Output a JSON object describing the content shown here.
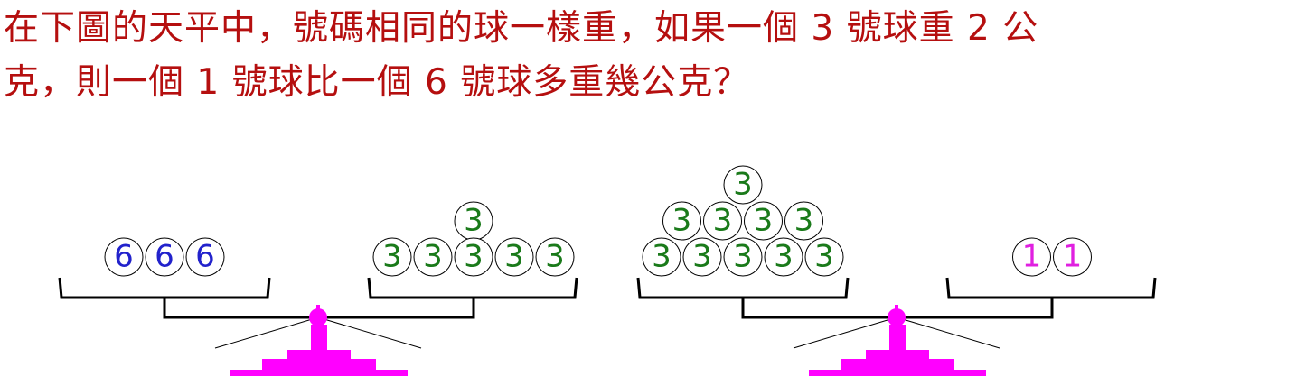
{
  "question": {
    "line1": "在下圖的天平中，號碼相同的球一樣重，如果一個 3 號球重 2 公",
    "line2": "克，則一個 1 號球比一個 6 號球多重幾公克？"
  },
  "colors": {
    "question_text": "#b50f0f",
    "scale_body": "#ff00ff",
    "ball_6": "#2222cc",
    "ball_3": "#1a7a1a",
    "ball_1": "#e020e0",
    "pan_outline": "#000000"
  },
  "scales": [
    {
      "left_pan": {
        "rows": [
          [
            "6",
            "6",
            "6"
          ]
        ]
      },
      "right_pan": {
        "rows": [
          [
            "3"
          ],
          [
            "3",
            "3",
            "3",
            "3",
            "3"
          ]
        ]
      }
    },
    {
      "left_pan": {
        "rows": [
          [
            "3"
          ],
          [
            "3",
            "3",
            "3",
            "3"
          ],
          [
            "3",
            "3",
            "3",
            "3",
            "3"
          ]
        ]
      },
      "right_pan": {
        "rows": [
          [
            "1",
            "1"
          ]
        ]
      }
    }
  ]
}
